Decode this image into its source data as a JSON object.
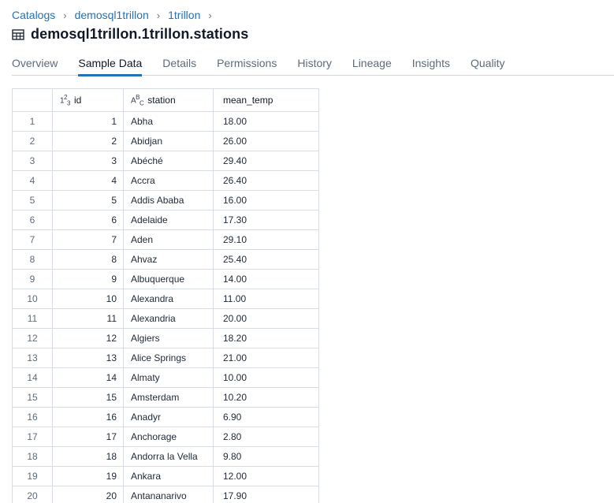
{
  "breadcrumb": [
    "Catalogs",
    "demosql1trillon",
    "1trillon"
  ],
  "title": "demosql1trillon.1trillon.stations",
  "icons": {
    "breadcrumb_sep": "chevron-right-icon",
    "title": "table-icon"
  },
  "tabs": [
    {
      "label": "Overview",
      "active": false
    },
    {
      "label": "Sample Data",
      "active": true
    },
    {
      "label": "Details",
      "active": false
    },
    {
      "label": "Permissions",
      "active": false
    },
    {
      "label": "History",
      "active": false
    },
    {
      "label": "Lineage",
      "active": false
    },
    {
      "label": "Insights",
      "active": false
    },
    {
      "label": "Quality",
      "active": false
    }
  ],
  "accent_color": "#2272b4",
  "table": {
    "columns": [
      {
        "name": "id",
        "type_badge": "123"
      },
      {
        "name": "station",
        "type_badge": "ABC"
      },
      {
        "name": "mean_temp",
        "type_badge": ""
      }
    ],
    "rows": [
      [
        "1",
        "1",
        "Abha",
        "18.00"
      ],
      [
        "2",
        "2",
        "Abidjan",
        "26.00"
      ],
      [
        "3",
        "3",
        "Abéché",
        "29.40"
      ],
      [
        "4",
        "4",
        "Accra",
        "26.40"
      ],
      [
        "5",
        "5",
        "Addis Ababa",
        "16.00"
      ],
      [
        "6",
        "6",
        "Adelaide",
        "17.30"
      ],
      [
        "7",
        "7",
        "Aden",
        "29.10"
      ],
      [
        "8",
        "8",
        "Ahvaz",
        "25.40"
      ],
      [
        "9",
        "9",
        "Albuquerque",
        "14.00"
      ],
      [
        "10",
        "10",
        "Alexandra",
        "11.00"
      ],
      [
        "11",
        "11",
        "Alexandria",
        "20.00"
      ],
      [
        "12",
        "12",
        "Algiers",
        "18.20"
      ],
      [
        "13",
        "13",
        "Alice Springs",
        "21.00"
      ],
      [
        "14",
        "14",
        "Almaty",
        "10.00"
      ],
      [
        "15",
        "15",
        "Amsterdam",
        "10.20"
      ],
      [
        "16",
        "16",
        "Anadyr",
        "6.90"
      ],
      [
        "17",
        "17",
        "Anchorage",
        "2.80"
      ],
      [
        "18",
        "18",
        "Andorra la Vella",
        "9.80"
      ],
      [
        "19",
        "19",
        "Ankara",
        "12.00"
      ],
      [
        "20",
        "20",
        "Antananarivo",
        "17.90"
      ]
    ]
  }
}
